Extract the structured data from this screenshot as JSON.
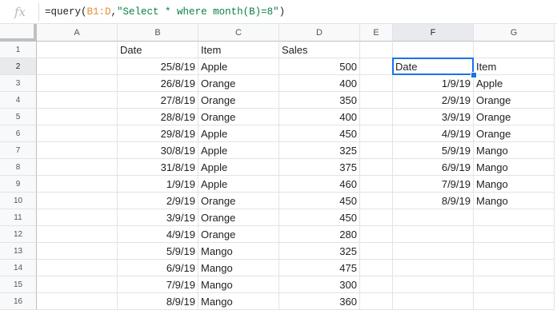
{
  "formula_bar": {
    "fx_label": "fx",
    "segments": [
      {
        "text": "=query(",
        "kind": "plain"
      },
      {
        "text": "B1:D",
        "kind": "ref"
      },
      {
        "text": ",",
        "kind": "plain"
      },
      {
        "text": "\"Select * where month(B)=8\"",
        "kind": "str"
      },
      {
        "text": ")",
        "kind": "plain"
      }
    ]
  },
  "columns": [
    "A",
    "B",
    "C",
    "D",
    "E",
    "F",
    "G"
  ],
  "selected_column": "F",
  "selected_row": 2,
  "rows": [
    {
      "n": "1",
      "A": "",
      "B": "Date",
      "C": "Item",
      "D": "Sales",
      "E": "",
      "F": "",
      "G": ""
    },
    {
      "n": "2",
      "A": "",
      "B": "25/8/19",
      "C": "Apple",
      "D": "500",
      "E": "",
      "F": "Date",
      "G": "Item"
    },
    {
      "n": "3",
      "A": "",
      "B": "26/8/19",
      "C": "Orange",
      "D": "400",
      "E": "",
      "F": "1/9/19",
      "G": "Apple"
    },
    {
      "n": "4",
      "A": "",
      "B": "27/8/19",
      "C": "Orange",
      "D": "350",
      "E": "",
      "F": "2/9/19",
      "G": "Orange"
    },
    {
      "n": "5",
      "A": "",
      "B": "28/8/19",
      "C": "Orange",
      "D": "400",
      "E": "",
      "F": "3/9/19",
      "G": "Orange"
    },
    {
      "n": "6",
      "A": "",
      "B": "29/8/19",
      "C": "Apple",
      "D": "450",
      "E": "",
      "F": "4/9/19",
      "G": "Orange"
    },
    {
      "n": "7",
      "A": "",
      "B": "30/8/19",
      "C": "Apple",
      "D": "325",
      "E": "",
      "F": "5/9/19",
      "G": "Mango"
    },
    {
      "n": "8",
      "A": "",
      "B": "31/8/19",
      "C": "Apple",
      "D": "375",
      "E": "",
      "F": "6/9/19",
      "G": "Mango"
    },
    {
      "n": "9",
      "A": "",
      "B": "1/9/19",
      "C": "Apple",
      "D": "460",
      "E": "",
      "F": "7/9/19",
      "G": "Mango"
    },
    {
      "n": "10",
      "A": "",
      "B": "2/9/19",
      "C": "Orange",
      "D": "450",
      "E": "",
      "F": "8/9/19",
      "G": "Mango"
    },
    {
      "n": "11",
      "A": "",
      "B": "3/9/19",
      "C": "Orange",
      "D": "450",
      "E": "",
      "F": "",
      "G": ""
    },
    {
      "n": "12",
      "A": "",
      "B": "4/9/19",
      "C": "Orange",
      "D": "280",
      "E": "",
      "F": "",
      "G": ""
    },
    {
      "n": "13",
      "A": "",
      "B": "5/9/19",
      "C": "Mango",
      "D": "325",
      "E": "",
      "F": "",
      "G": ""
    },
    {
      "n": "14",
      "A": "",
      "B": "6/9/19",
      "C": "Mango",
      "D": "475",
      "E": "",
      "F": "",
      "G": ""
    },
    {
      "n": "15",
      "A": "",
      "B": "7/9/19",
      "C": "Mango",
      "D": "300",
      "E": "",
      "F": "",
      "G": ""
    },
    {
      "n": "16",
      "A": "",
      "B": "8/9/19",
      "C": "Mango",
      "D": "360",
      "E": "",
      "F": "",
      "G": ""
    }
  ],
  "right_aligned": {
    "B": [
      false,
      true,
      true,
      true,
      true,
      true,
      true,
      true,
      true,
      true,
      true,
      true,
      true,
      true,
      true,
      true
    ],
    "D": [
      false,
      true,
      true,
      true,
      true,
      true,
      true,
      true,
      true,
      true,
      true,
      true,
      true,
      true,
      true,
      true
    ],
    "F": [
      false,
      false,
      true,
      true,
      true,
      true,
      true,
      true,
      true,
      true,
      false,
      false,
      false,
      false,
      false,
      false
    ]
  },
  "colors": {
    "selection": "#1a73e8",
    "ref": "#e69138",
    "string": "#0b8043"
  }
}
